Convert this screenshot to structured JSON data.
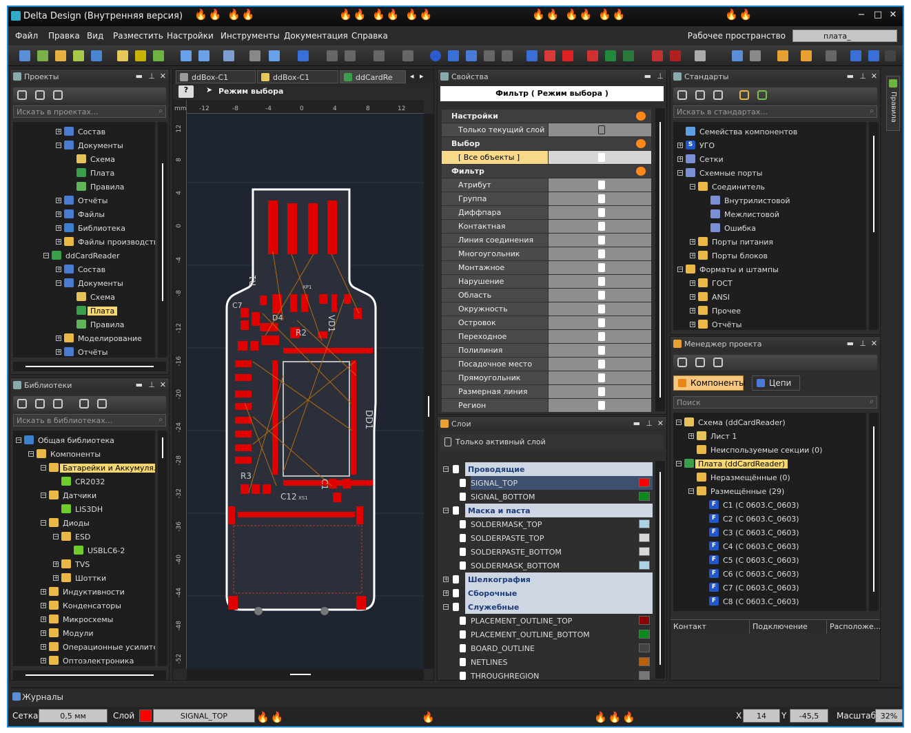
{
  "window": {
    "title": "Delta Design (Внутренняя версия)"
  },
  "menu": {
    "items": [
      "Файл",
      "Правка",
      "Вид",
      "Разместить",
      "Настройки",
      "Инструменты",
      "Документация",
      "Справка"
    ],
    "workspace_label": "Рабочее пространство",
    "workspace_value": "плата_"
  },
  "projects": {
    "title": "Проекты",
    "search_placeholder": "Искать в проектах...",
    "items": [
      {
        "label": "Состав",
        "level": 3,
        "icon": "ic-doc",
        "exp": "+"
      },
      {
        "label": "Документы",
        "level": 3,
        "icon": "ic-doc",
        "exp": "−"
      },
      {
        "label": "Схема",
        "level": 4,
        "icon": "ic-sch",
        "exp": ""
      },
      {
        "label": "Плата",
        "level": 4,
        "icon": "ic-brd",
        "exp": ""
      },
      {
        "label": "Правила",
        "level": 4,
        "icon": "ic-rule",
        "exp": ""
      },
      {
        "label": "Отчёты",
        "level": 3,
        "icon": "ic-doc",
        "exp": "+"
      },
      {
        "label": "Файлы",
        "level": 3,
        "icon": "ic-doc",
        "exp": "+"
      },
      {
        "label": "Библиотека",
        "level": 3,
        "icon": "ic-lib",
        "exp": "+"
      },
      {
        "label": "Файлы производства",
        "level": 3,
        "icon": "ic-fold",
        "exp": "+"
      },
      {
        "label": "ddCardReader",
        "level": 2,
        "icon": "ic-brd",
        "exp": "−"
      },
      {
        "label": "Состав",
        "level": 3,
        "icon": "ic-doc",
        "exp": "+"
      },
      {
        "label": "Документы",
        "level": 3,
        "icon": "ic-doc",
        "exp": "−"
      },
      {
        "label": "Схема",
        "level": 4,
        "icon": "ic-sch",
        "exp": ""
      },
      {
        "label": "Плата",
        "level": 4,
        "icon": "ic-brd",
        "exp": "",
        "sel": true
      },
      {
        "label": "Правила",
        "level": 4,
        "icon": "ic-rule",
        "exp": ""
      },
      {
        "label": "Моделирование",
        "level": 3,
        "icon": "ic-fold",
        "exp": "+"
      },
      {
        "label": "Отчёты",
        "level": 3,
        "icon": "ic-doc",
        "exp": "+"
      }
    ]
  },
  "libraries": {
    "title": "Библиотеки",
    "search_placeholder": "Искать в библиотеках...",
    "items": [
      {
        "label": "Общая библиотека",
        "level": 0,
        "icon": "ic-lib",
        "exp": "−"
      },
      {
        "label": "Компоненты",
        "level": 1,
        "icon": "ic-fold",
        "exp": "−"
      },
      {
        "label": "Батарейки и Аккумуля...",
        "level": 2,
        "icon": "ic-fold",
        "exp": "−",
        "sel": true
      },
      {
        "label": "CR2032",
        "level": 3,
        "icon": "ic-green",
        "exp": ""
      },
      {
        "label": "Датчики",
        "level": 2,
        "icon": "ic-fold",
        "exp": "−"
      },
      {
        "label": "LIS3DH",
        "level": 3,
        "icon": "ic-green",
        "exp": ""
      },
      {
        "label": "Диоды",
        "level": 2,
        "icon": "ic-fold",
        "exp": "−"
      },
      {
        "label": "ESD",
        "level": 3,
        "icon": "ic-fold",
        "exp": "−"
      },
      {
        "label": "USBLC6-2",
        "level": 4,
        "icon": "ic-green",
        "exp": ""
      },
      {
        "label": "TVS",
        "level": 3,
        "icon": "ic-fold",
        "exp": "+"
      },
      {
        "label": "Шоттки",
        "level": 3,
        "icon": "ic-fold",
        "exp": "+"
      },
      {
        "label": "Индуктивности",
        "level": 2,
        "icon": "ic-fold",
        "exp": "+"
      },
      {
        "label": "Конденсаторы",
        "level": 2,
        "icon": "ic-fold",
        "exp": "+"
      },
      {
        "label": "Микросхемы",
        "level": 2,
        "icon": "ic-fold",
        "exp": "+"
      },
      {
        "label": "Модули",
        "level": 2,
        "icon": "ic-fold",
        "exp": "+"
      },
      {
        "label": "Операционные усилители",
        "level": 2,
        "icon": "ic-fold",
        "exp": "+"
      },
      {
        "label": "Оптоэлектроника",
        "level": 2,
        "icon": "ic-fold",
        "exp": "+"
      }
    ]
  },
  "editor": {
    "tabs": [
      "ddBox-C1",
      "ddBox-C1",
      "ddCardRe"
    ],
    "mode": "Режим выбора",
    "unit": "mm",
    "ruler_x": [
      "-12",
      "-8",
      "-4",
      "0",
      "4",
      "8",
      "12"
    ],
    "ruler_y": [
      "12",
      "8",
      "4",
      "0",
      "-4",
      "-8",
      "-12",
      "-16",
      "-20",
      "-24",
      "-28",
      "-32",
      "-36",
      "-40",
      "-44",
      "-48",
      "-52"
    ],
    "refdes": [
      "XP1",
      "R2",
      "VD1",
      "R3",
      "C12",
      "DD1",
      "XS1",
      "C1",
      "D4",
      "R1",
      "C7"
    ]
  },
  "properties": {
    "title": "Свойства",
    "filter_title": "Фильтр ( Режим выбора )",
    "rows": [
      {
        "n": "Настройки",
        "sect": true
      },
      {
        "n": "Только текущий слой"
      },
      {
        "n": "Выбор",
        "sect": true
      },
      {
        "n": "[ Все объекты ]",
        "hl": true
      },
      {
        "n": "Фильтр",
        "sect": true
      },
      {
        "n": "Атрибут"
      },
      {
        "n": "Группа"
      },
      {
        "n": "Диффпара"
      },
      {
        "n": "Контактная площадка"
      },
      {
        "n": "Линия соединения"
      },
      {
        "n": "Многоугольник"
      },
      {
        "n": "Монтажное отверстие"
      },
      {
        "n": "Нарушение"
      },
      {
        "n": "Область металлизации"
      },
      {
        "n": "Окружность"
      },
      {
        "n": "Островок металлизации"
      },
      {
        "n": "Переходное отверстие"
      },
      {
        "n": "Полилиния"
      },
      {
        "n": "Посадочное место"
      },
      {
        "n": "Прямоугольник"
      },
      {
        "n": "Размерная линия"
      },
      {
        "n": "Регион"
      }
    ]
  },
  "layers": {
    "title": "Слои",
    "active_only": "Только активный слой",
    "rows": [
      {
        "n": "Проводящие",
        "grp": true,
        "exp": "−"
      },
      {
        "n": "SIGNAL_TOP",
        "sw": "#ff0000",
        "sel": true
      },
      {
        "n": "SIGNAL_BOTTOM",
        "sw": "#0a8a1a"
      },
      {
        "n": "Маска и паста",
        "grp": true,
        "exp": "−"
      },
      {
        "n": "SOLDERMASK_TOP",
        "sw": "#a8d4e6"
      },
      {
        "n": "SOLDERPASTE_TOP",
        "sw": "#d8d8d8"
      },
      {
        "n": "SOLDERPASTE_BOTTOM",
        "sw": "#d8d8d8"
      },
      {
        "n": "SOLDERMASK_BOTTOM",
        "sw": "#a8d4e6"
      },
      {
        "n": "Шелкография",
        "grp": true,
        "exp": "+"
      },
      {
        "n": "Сборочные",
        "grp": true,
        "exp": "+"
      },
      {
        "n": "Служебные",
        "grp": true,
        "exp": "−"
      },
      {
        "n": "PLACEMENT_OUTLINE_TOP",
        "sw": "#8b0000"
      },
      {
        "n": "PLACEMENT_OUTLINE_BOTTOM",
        "sw": "#0a8a1a"
      },
      {
        "n": "BOARD_OUTLINE",
        "sw": "#444444"
      },
      {
        "n": "NETLINES",
        "sw": "#b8600a"
      },
      {
        "n": "THROUGHREGION",
        "sw": "#777777"
      }
    ]
  },
  "standards": {
    "title": "Стандарты",
    "search_placeholder": "Искать в стандартах...",
    "items": [
      {
        "label": "Семейства компонентов",
        "level": 0,
        "icon": "ic-comp",
        "exp": ""
      },
      {
        "label": "УГО",
        "level": 0,
        "icon": "ic-f",
        "exp": "+",
        "txt": "S"
      },
      {
        "label": "Сетки",
        "level": 0,
        "icon": "ic-port",
        "exp": "+"
      },
      {
        "label": "Схемные порты",
        "level": 0,
        "icon": "ic-port",
        "exp": "−"
      },
      {
        "label": "Соединитель",
        "level": 1,
        "icon": "ic-fold",
        "exp": "−"
      },
      {
        "label": "Внутрилистовой",
        "level": 2,
        "icon": "ic-port",
        "exp": ""
      },
      {
        "label": "Межлистовой",
        "level": 2,
        "icon": "ic-port",
        "exp": ""
      },
      {
        "label": "Ошибка",
        "level": 2,
        "icon": "ic-port",
        "exp": ""
      },
      {
        "label": "Порты питания",
        "level": 1,
        "icon": "ic-fold",
        "exp": "+"
      },
      {
        "label": "Порты блоков",
        "level": 1,
        "icon": "ic-fold",
        "exp": "+"
      },
      {
        "label": "Форматы и штампы",
        "level": 0,
        "icon": "ic-fold",
        "exp": "−"
      },
      {
        "label": "ГОСТ",
        "level": 1,
        "icon": "ic-fold",
        "exp": "+"
      },
      {
        "label": "ANSI",
        "level": 1,
        "icon": "ic-fold",
        "exp": "+"
      },
      {
        "label": "Прочее",
        "level": 1,
        "icon": "ic-fold",
        "exp": "+"
      },
      {
        "label": "Отчёты",
        "level": 1,
        "icon": "ic-fold",
        "exp": "+"
      }
    ]
  },
  "project_manager": {
    "title": "Менеджер проекта",
    "tab_components": "Компоненты",
    "tab_nets": "Цепи",
    "search_placeholder": "Поиск",
    "items": [
      {
        "label": "Схема (ddCardReader)",
        "level": 0,
        "icon": "ic-sch",
        "exp": "−"
      },
      {
        "label": "Лист 1",
        "level": 1,
        "icon": "ic-sch",
        "exp": "+"
      },
      {
        "label": "Неиспользуемые секции (0)",
        "level": 1,
        "icon": "ic-fold",
        "exp": ""
      },
      {
        "label": "Плата (ddCardReader)",
        "level": 0,
        "icon": "ic-brd",
        "exp": "−",
        "sel": true
      },
      {
        "label": "Неразмещённые (0)",
        "level": 1,
        "icon": "ic-fold",
        "exp": ""
      },
      {
        "label": "Размещённые (29)",
        "level": 1,
        "icon": "ic-fold",
        "exp": "−"
      },
      {
        "label": "C1 (C 0603.C_0603)",
        "level": 2,
        "icon": "ic-f",
        "exp": "",
        "txt": "F"
      },
      {
        "label": "C2 (C 0603.C_0603)",
        "level": 2,
        "icon": "ic-f",
        "exp": "",
        "txt": "F"
      },
      {
        "label": "C3 (C 0603.C_0603)",
        "level": 2,
        "icon": "ic-f",
        "exp": "",
        "txt": "F"
      },
      {
        "label": "C4 (C 0603.C_0603)",
        "level": 2,
        "icon": "ic-f",
        "exp": "",
        "txt": "F"
      },
      {
        "label": "C5 (C 0603.C_0603)",
        "level": 2,
        "icon": "ic-f",
        "exp": "",
        "txt": "F"
      },
      {
        "label": "C6 (C 0603.C_0603)",
        "level": 2,
        "icon": "ic-f",
        "exp": "",
        "txt": "F"
      },
      {
        "label": "C7 (C 0603.C_0603)",
        "level": 2,
        "icon": "ic-f",
        "exp": "",
        "txt": "F"
      },
      {
        "label": "C8 (C 0603.C_0603)",
        "level": 2,
        "icon": "ic-f",
        "exp": "",
        "txt": "F"
      }
    ],
    "columns": [
      "Контакт",
      "Подключение",
      "Расположе..."
    ]
  },
  "side_tab": "Правила",
  "journal": "Журналы",
  "status": {
    "grid_label": "Сетка:",
    "grid_value": "0,5 мм",
    "layer_label": "Слой",
    "layer_value": "SIGNAL_TOP",
    "layer_color": "#ff0000",
    "x_label": "X",
    "x_value": "14",
    "y_label": "Y",
    "y_value": "-45,5",
    "zoom_label": "Масштаб",
    "zoom_value": "32%"
  }
}
